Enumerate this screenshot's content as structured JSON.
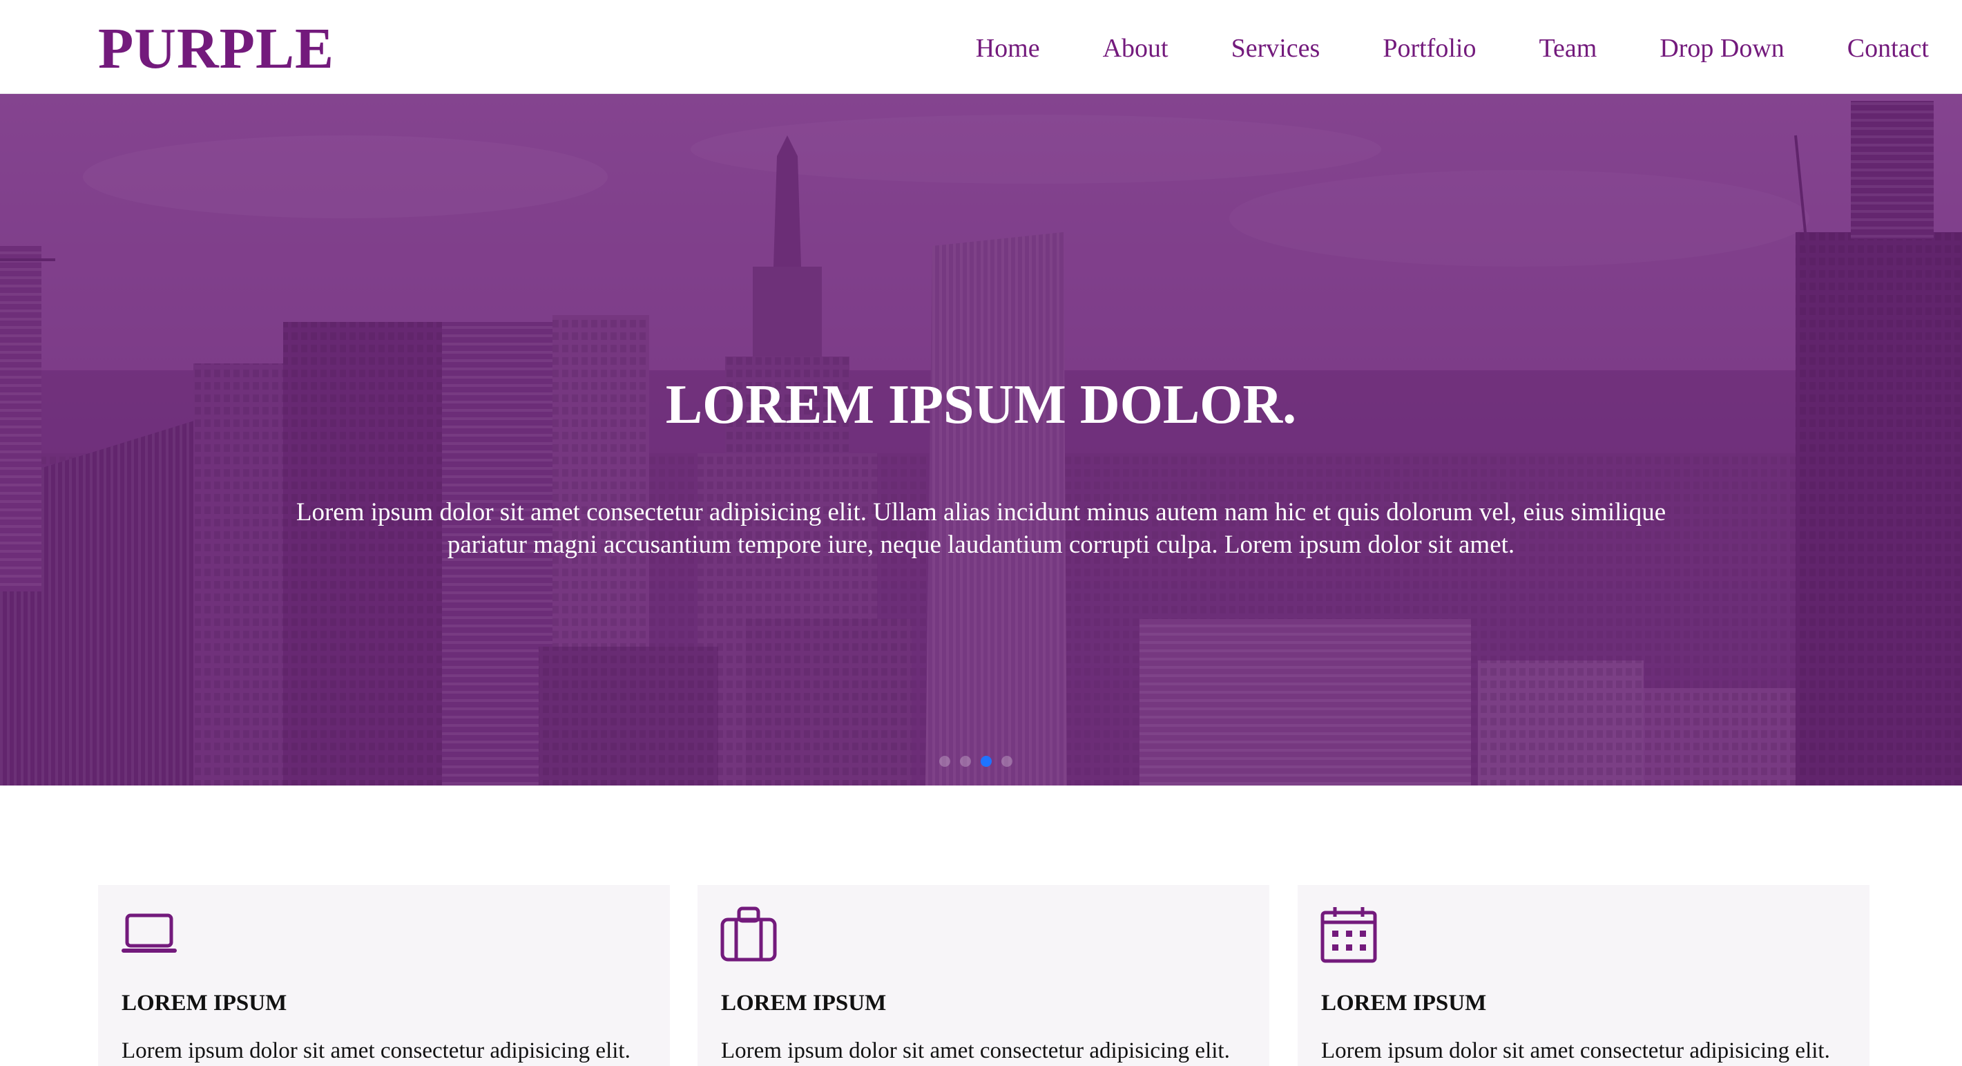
{
  "brand": {
    "name": "PURPLE",
    "color": "#731a7c"
  },
  "nav": {
    "items": [
      {
        "label": "Home"
      },
      {
        "label": "About"
      },
      {
        "label": "Services"
      },
      {
        "label": "Portfolio"
      },
      {
        "label": "Team"
      },
      {
        "label": "Drop Down"
      },
      {
        "label": "Contact"
      }
    ]
  },
  "hero": {
    "title": "LOREM IPSUM DOLOR.",
    "text": "Lorem ipsum dolor sit amet consectetur adipisicing elit. Ullam alias incidunt minus autem nam hic et quis dolorum vel, eius similique pariatur magni accusantium tempore iure, neque laudantium corrupti culpa. Lorem ipsum dolor sit amet.",
    "slides_total": 4,
    "active_slide": 3,
    "overlay_color": "#80248c",
    "dot_active_color": "#1e74ff"
  },
  "features": [
    {
      "icon": "laptop-icon",
      "title": "LOREM IPSUM",
      "description": "Lorem ipsum dolor sit amet consectetur adipisicing elit."
    },
    {
      "icon": "briefcase-icon",
      "title": "LOREM IPSUM",
      "description": "Lorem ipsum dolor sit amet consectetur adipisicing elit."
    },
    {
      "icon": "calendar-icon",
      "title": "LOREM IPSUM",
      "description": "Lorem ipsum dolor sit amet consectetur adipisicing elit."
    }
  ]
}
